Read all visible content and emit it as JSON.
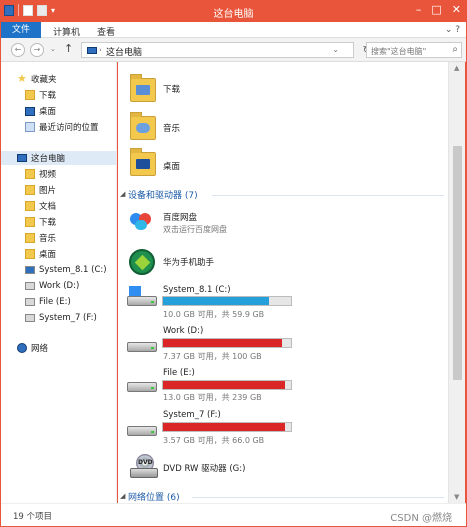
{
  "window": {
    "title": "这台电脑"
  },
  "ribbon": {
    "file": "文件",
    "tabs": [
      "计算机",
      "查看"
    ]
  },
  "address": {
    "path": "这台电脑",
    "search_placeholder": "搜索\"这台电脑\""
  },
  "nav": {
    "favorites": "收藏夹",
    "favorites_items": [
      "下载",
      "桌面",
      "最近访问的位置"
    ],
    "this_pc": "这台电脑",
    "pc_items": [
      "视频",
      "图片",
      "文档",
      "下载",
      "音乐",
      "桌面"
    ],
    "drives": [
      "System_8.1 (C:)",
      "Work (D:)",
      "File (E:)",
      "System_7 (F:)"
    ],
    "network": "网络"
  },
  "main": {
    "folders": [
      "下载",
      "音乐",
      "桌面"
    ],
    "devices_header": "设备和驱动器 (7)",
    "apps": [
      {
        "name": "百度网盘",
        "sub": "双击运行百度网盘"
      },
      {
        "name": "华为手机助手",
        "sub": ""
      }
    ],
    "drives": [
      {
        "name": "System_8.1 (C:)",
        "info": "10.0 GB 可用，共 59.9 GB",
        "used_fraction": 0.83,
        "color": "#26a0da"
      },
      {
        "name": "Work (D:)",
        "info": "7.37 GB 可用，共 100 GB",
        "used_fraction": 0.93,
        "color": "#da2626"
      },
      {
        "name": "File (E:)",
        "info": "13.0 GB 可用，共 239 GB",
        "used_fraction": 0.95,
        "color": "#da2626"
      },
      {
        "name": "System_7 (F:)",
        "info": "3.57 GB 可用，共 66.0 GB",
        "used_fraction": 0.95,
        "color": "#da2626"
      }
    ],
    "dvd": "DVD RW 驱动器 (G:)",
    "network_header": "网络位置 (6)"
  },
  "status": {
    "count": "19 个项目",
    "watermark": "CSDN @燃烧"
  }
}
